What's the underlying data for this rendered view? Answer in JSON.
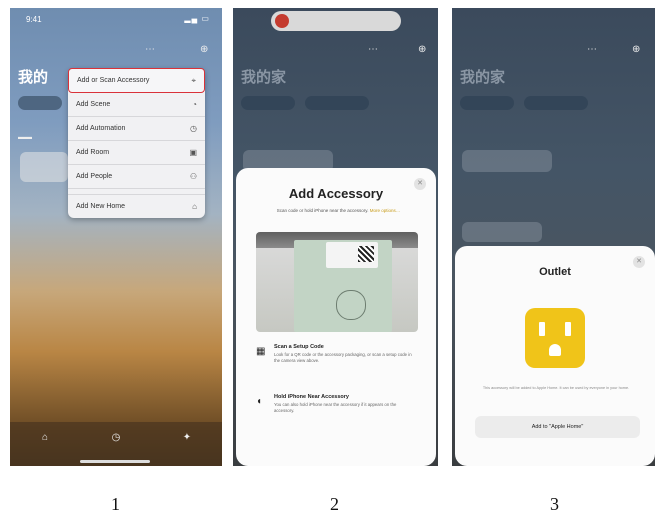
{
  "screen1": {
    "status_time": "9:41",
    "home_title": "我的",
    "menu_items": [
      {
        "label": "Add or Scan Accessory",
        "icon": "scan-icon",
        "glyph": "⌖",
        "highlight": true
      },
      {
        "label": "Add Scene",
        "icon": "scene-icon",
        "glyph": "◔"
      },
      {
        "label": "Add Automation",
        "icon": "automation-icon",
        "glyph": "◷"
      },
      {
        "label": "Add Room",
        "icon": "room-icon",
        "glyph": "▣"
      },
      {
        "label": "Add People",
        "icon": "people-icon",
        "glyph": "⚇"
      },
      {
        "label": "Add New Home",
        "icon": "home-icon",
        "glyph": "⌂"
      }
    ]
  },
  "screen2": {
    "home_title": "我的家",
    "sheet": {
      "title": "Add Accessory",
      "subtitle": "Scan code or hold iPhone near the accessory.",
      "link": "More options…",
      "options": [
        {
          "title": "Scan a Setup Code",
          "body": "Look for a QR code or the accessory packaging, or scan a setup code in the camera view above.",
          "icon": "qr-code-icon",
          "glyph": "▦"
        },
        {
          "title": "Hold iPhone Near Accessory",
          "body": "You can also hold iPhone near the accessory if it appears on the accessory.",
          "icon": "nfc-icon",
          "glyph": "◖"
        }
      ]
    }
  },
  "screen3": {
    "home_title": "我的家",
    "sheet": {
      "title": "Outlet",
      "fineprint": "This accessory will be added to Apple Home. It can be used by everyone in your home.",
      "button": "Add to \"Apple Home\""
    }
  },
  "captions": [
    "1",
    "2",
    "3"
  ],
  "colors": {
    "highlight": "#d9323a",
    "outlet": "#f0c419",
    "link": "#c79a16"
  }
}
